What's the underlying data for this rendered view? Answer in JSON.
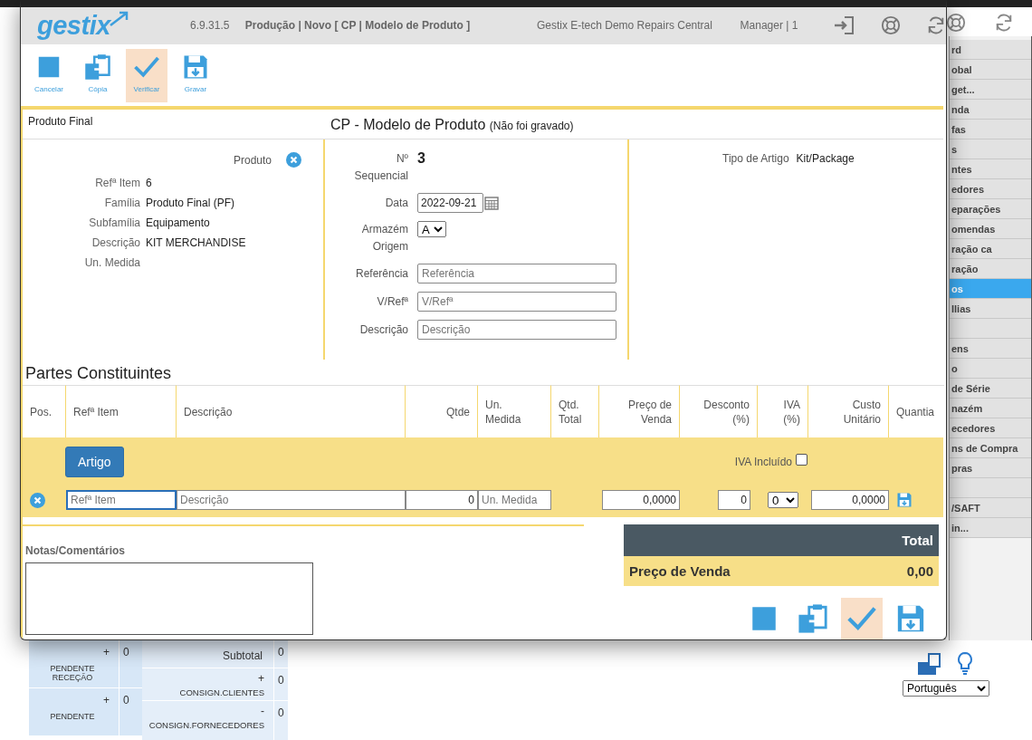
{
  "background": {
    "sidebar_items": [
      {
        "label": "rd",
        "selected": false
      },
      {
        "label": "obal",
        "selected": false
      },
      {
        "label": "get...",
        "selected": false
      },
      {
        "label": "nda",
        "selected": false
      },
      {
        "label": "fas",
        "selected": false
      },
      {
        "label": "s",
        "selected": false
      },
      {
        "label": "ntes",
        "selected": false
      },
      {
        "label": "edores",
        "selected": false
      },
      {
        "label": "eparações",
        "selected": false
      },
      {
        "label": "omendas",
        "selected": false
      },
      {
        "label": "ração ca",
        "selected": false
      },
      {
        "label": "ração",
        "selected": false
      },
      {
        "label": "os",
        "selected": true
      },
      {
        "label": "llias",
        "selected": false
      },
      {
        "selected": false
      },
      {
        "label": "ens",
        "selected": false
      },
      {
        "label": "o",
        "selected": false
      },
      {
        "label": "de Série",
        "selected": false
      },
      {
        "label": "nazém",
        "selected": false
      },
      {
        "label": "ecedores",
        "selected": false
      },
      {
        "label": "ns de Compra",
        "selected": false
      },
      {
        "label": "pras",
        "selected": false
      },
      {
        "selected": false
      },
      {
        "label": "/SAFT",
        "selected": false
      },
      {
        "label": "in...",
        "selected": false
      }
    ],
    "summary": {
      "column_1": [
        {
          "kind": "entry",
          "sign": "+",
          "count": "0",
          "label": "PENDENTE RECEÇÃO"
        },
        {
          "kind": "entry",
          "sign": "+",
          "count": "0",
          "label": "PENDENTE"
        }
      ],
      "column_2": [
        {
          "kind": "total",
          "label": "Subtotal",
          "count": "0"
        },
        {
          "kind": "entry",
          "sign": "+",
          "label": "CONSIGN.CLIENTES",
          "count": "0"
        },
        {
          "kind": "entry",
          "sign": "-",
          "label": "CONSIGN.FORNECEDORES",
          "count": "0"
        }
      ]
    },
    "language_select": {
      "value": "Português"
    }
  },
  "window": {
    "app_name": "gestix",
    "version": "6.9.31.5",
    "title": "Produção | Novo [ CP | Modelo de Produto ]",
    "company": "Gestix E-tech Demo Repairs Central",
    "user": "Manager | 1"
  },
  "toolbar": [
    {
      "kind": "cancel",
      "label": "Cancelar",
      "selected": false
    },
    {
      "kind": "copy",
      "label": "Cópia",
      "selected": false
    },
    {
      "kind": "verify",
      "label": "Verificar",
      "selected": true
    },
    {
      "kind": "save",
      "label": "Gravar",
      "selected": false
    }
  ],
  "form": {
    "section": "Produto Final",
    "title": "CP - Modelo de Produto",
    "status": "(Não foi gravado)",
    "product": {
      "label": "Produto",
      "fields": [
        {
          "label": "Refª Item",
          "value": "6"
        },
        {
          "label": "Família",
          "value": "Produto Final (PF)"
        },
        {
          "label": "Subfamília",
          "value": "Equipamento"
        },
        {
          "label": "Descrição",
          "value": "KIT MERCHANDISE"
        },
        {
          "label": "Un. Medida"
        }
      ]
    },
    "document": [
      {
        "kind": "value",
        "label": "Nº\nSequencial",
        "value": "3"
      },
      {
        "kind": "date",
        "label": "Data",
        "value": "2022-09-21"
      },
      {
        "kind": "select",
        "label": "Armazém\nOrigem",
        "value": "A"
      },
      {
        "kind": "input",
        "label": "Referência",
        "placeholder": "Referência"
      },
      {
        "kind": "input",
        "label": "V/Refª",
        "placeholder": "V/Refª"
      },
      {
        "kind": "input",
        "label": "Descrição",
        "placeholder": "Descrição"
      }
    ],
    "type": {
      "label": "Tipo de Artigo",
      "value": "Kit/Package"
    }
  },
  "parts": {
    "title": "Partes Constituintes",
    "columns": [
      "Pos.",
      "Refª Item",
      "Descrição",
      "Qtde",
      "Un.\nMedida",
      "Qtd.\nTotal",
      "Preço de\nVenda",
      "Desconto\n(%)",
      "IVA\n(%)",
      "Custo\nUnitário",
      "Quantia"
    ],
    "add_button": "Artigo",
    "vat_included": {
      "label": "IVA Incluído",
      "checked": false
    },
    "entry": [
      {
        "kind": "remove"
      },
      {
        "kind": "input",
        "placeholder": "Refª Item",
        "focused": true
      },
      {
        "kind": "input",
        "placeholder": "Descrição",
        "focused": false
      },
      {
        "kind": "number",
        "value": "0"
      },
      {
        "kind": "input",
        "placeholder": "Un. Medida",
        "focused": false
      },
      {
        "kind": "empty"
      },
      {
        "kind": "number",
        "value": "0,0000"
      },
      {
        "kind": "number",
        "value": "0"
      },
      {
        "kind": "select",
        "value": "0"
      },
      {
        "kind": "number",
        "value": "0,0000"
      },
      {
        "kind": "save"
      }
    ]
  },
  "notes": {
    "label": "Notas/Comentários"
  },
  "totals": {
    "header": "Total",
    "rows": [
      {
        "label": "Preço de Venda",
        "value": "0,00"
      }
    ]
  },
  "bottom_toolbar": [
    {
      "kind": "cancel",
      "selected": false
    },
    {
      "kind": "copy",
      "selected": false
    },
    {
      "kind": "verify",
      "selected": true
    },
    {
      "kind": "save",
      "selected": false
    }
  ]
}
